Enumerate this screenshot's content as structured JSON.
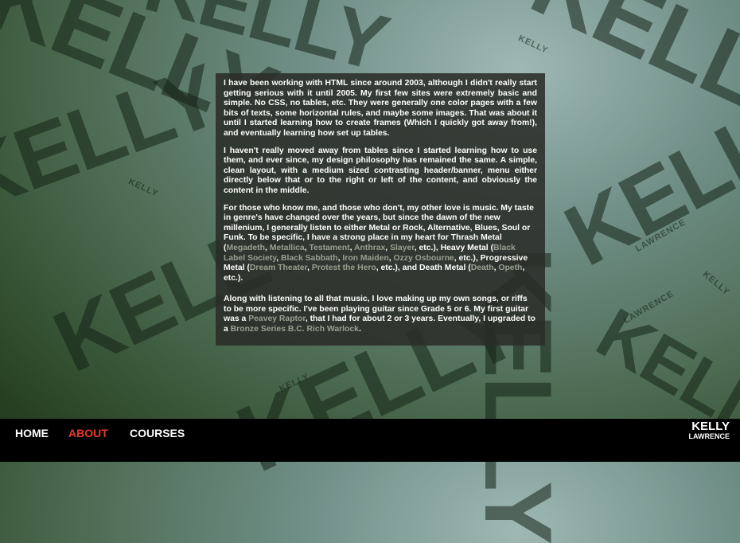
{
  "background": {
    "brand_word": "KELLY",
    "secondary_word": "LAWRENCE"
  },
  "content": {
    "paragraphs": [
      "I have been working with HTML since around 2003, although I didn't really start getting serious with it until 2005. My first few sites were extremely basic and simple. No CSS, no tables, etc. They were generally one color pages with a few bits of texts, some horizontal rules, and maybe some images. That was about it until I started learning how to create frames (Which I quickly got away from!), and eventually learning how set up tables.",
      "I haven't really moved away from tables since I started learning how to use them, and ever since, my design philosophy has remained the same. A simple, clean layout, with a medium sized contrasting header/banner, menu either directly below that or to the right or left of the content, and obviously the content in the middle."
    ],
    "music": {
      "intro": "For those who know me, and those who don't, my other love is music. My taste in genre's have changed over the years, but since the dawn of the new millenium, I generally listen to either Metal or Rock, Alternative, Blues, Soul or Funk. To be specific, I have a strong place in my heart for ",
      "thrash_label": "Thrash Metal (",
      "thrash_bands": [
        "Megadeth",
        "Metallica",
        "Testament",
        "Anthrax",
        "Slayer"
      ],
      "thrash_end": ", etc.),",
      "heavy_label": "Heavy Metal (",
      "heavy_bands": [
        "Black Label Society",
        "Black Sabbath",
        "Iron Maiden",
        "Ozzy Osbourne"
      ],
      "heavy_end": ", etc.),",
      "prog_label": "Progressive Metal (",
      "prog_bands": [
        "Dream Theater",
        "Protest the Hero"
      ],
      "prog_end": ", etc.),",
      "death_label": "and Death Metal (",
      "death_bands": [
        "Death",
        "Opeth"
      ],
      "death_end": ", etc.)."
    },
    "guitar": {
      "text1": "Along with listening to all that music, I love making up my own songs, or riffs to be more specific. I've been playing guitar since Grade 5 or 6. My first guitar was a ",
      "guitar1": "Peavey Raptor",
      "text2": ", that I had for about 2 or 3 years. Eventually, I upgraded to a ",
      "guitar2": "Bronze Series B.C. Rich Warlock",
      "text3": "."
    }
  },
  "nav": {
    "items": [
      {
        "label": "HOME",
        "active": false
      },
      {
        "label": "ABOUT",
        "active": true
      },
      {
        "label": "COURSES",
        "active": false
      }
    ]
  },
  "brand": {
    "name_top": "KELLY",
    "name_bottom": "LAWRENCE"
  },
  "colors": {
    "active_nav": "#e53b2a",
    "link_muted": "#9aa08f",
    "navbar_bg": "#000000"
  }
}
